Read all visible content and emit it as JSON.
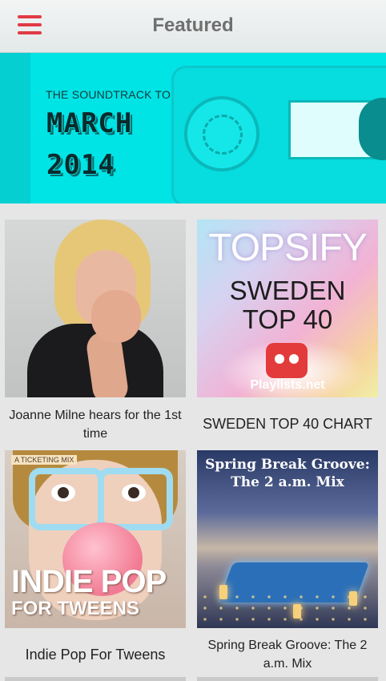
{
  "header": {
    "title": "Featured"
  },
  "banner": {
    "subtitle": "THE SOUNDTRACK TO",
    "line1": "MARCH",
    "line2": "2014"
  },
  "tiles": [
    {
      "caption": "Joanne Milne hears for the 1st time"
    },
    {
      "caption": "SWEDEN TOP 40 CHART",
      "art_text": {
        "brand": "TOPSIFY",
        "line1": "SWEDEN",
        "line2": "TOP 40",
        "site": "Playlists.net"
      }
    },
    {
      "caption": "Indie Pop For Tweens",
      "art_text": {
        "tag": "A TICKETING MIX",
        "line1": "INDIE POP",
        "line2": "FOR TWEENS"
      }
    },
    {
      "caption": "Spring Break Groove: The 2 a.m. Mix",
      "art_text": {
        "line1": "Spring Break Groove:",
        "line2": "The 2 a.m. Mix"
      }
    }
  ],
  "colors": {
    "accent": "#e13a45",
    "banner": "#00e4e6"
  },
  "icons": {
    "menu": "hamburger-menu-icon"
  }
}
